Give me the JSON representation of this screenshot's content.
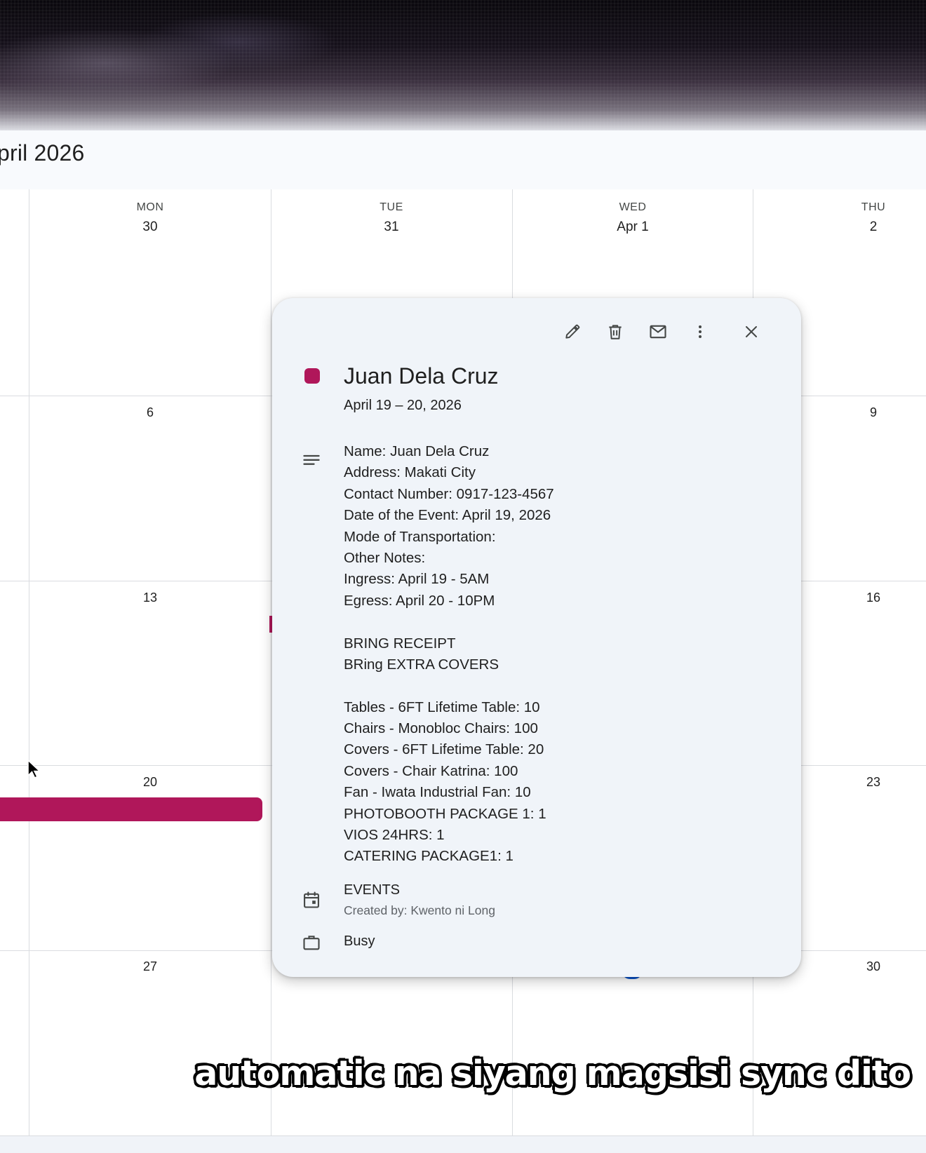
{
  "header": {
    "month_title": "pril 2026"
  },
  "calendar": {
    "weekdays": [
      {
        "dow": "MON",
        "date": "30"
      },
      {
        "dow": "TUE",
        "date": "31"
      },
      {
        "dow": "WED",
        "date": "Apr 1"
      },
      {
        "dow": "THU",
        "date": "2"
      }
    ],
    "week_numbers": {
      "w2": [
        "6",
        "9"
      ],
      "w3": [
        "13",
        "16"
      ],
      "w4": [
        "20",
        "23"
      ],
      "w5": [
        "27",
        "30"
      ]
    },
    "event_color": "#b0175a"
  },
  "popup": {
    "toolbar": {
      "edit": "edit-icon",
      "delete": "trash-icon",
      "email": "mail-icon",
      "more": "more-vert-icon",
      "close": "close-icon"
    },
    "title": "Juan Dela Cruz",
    "date_range": "April 19 – 20, 2026",
    "description_lines": [
      "Name: Juan Dela Cruz",
      "Address: Makati City",
      "Contact Number: 0917-123-4567",
      "Date of the Event: April 19, 2026",
      "Mode of Transportation:",
      "Other Notes:",
      "Ingress: April 19 - 5AM",
      "Egress: April 20 - 10PM",
      "",
      "BRING RECEIPT",
      "BRing EXTRA COVERS",
      "",
      "Tables - 6FT Lifetime Table: 10",
      "Chairs - Monobloc Chairs: 100",
      "Covers - 6FT Lifetime Table: 20",
      "Covers - Chair Katrina: 100",
      "Fan - Iwata Industrial Fan: 10",
      "PHOTOBOOTH PACKAGE 1: 1",
      "VIOS 24HRS: 1",
      "CATERING PACKAGE1: 1"
    ],
    "calendar_name": "EVENTS",
    "created_by": "Created by: Kwento ni Long",
    "availability": "Busy"
  },
  "caption": "automatic na siyang magsisi sync dito"
}
